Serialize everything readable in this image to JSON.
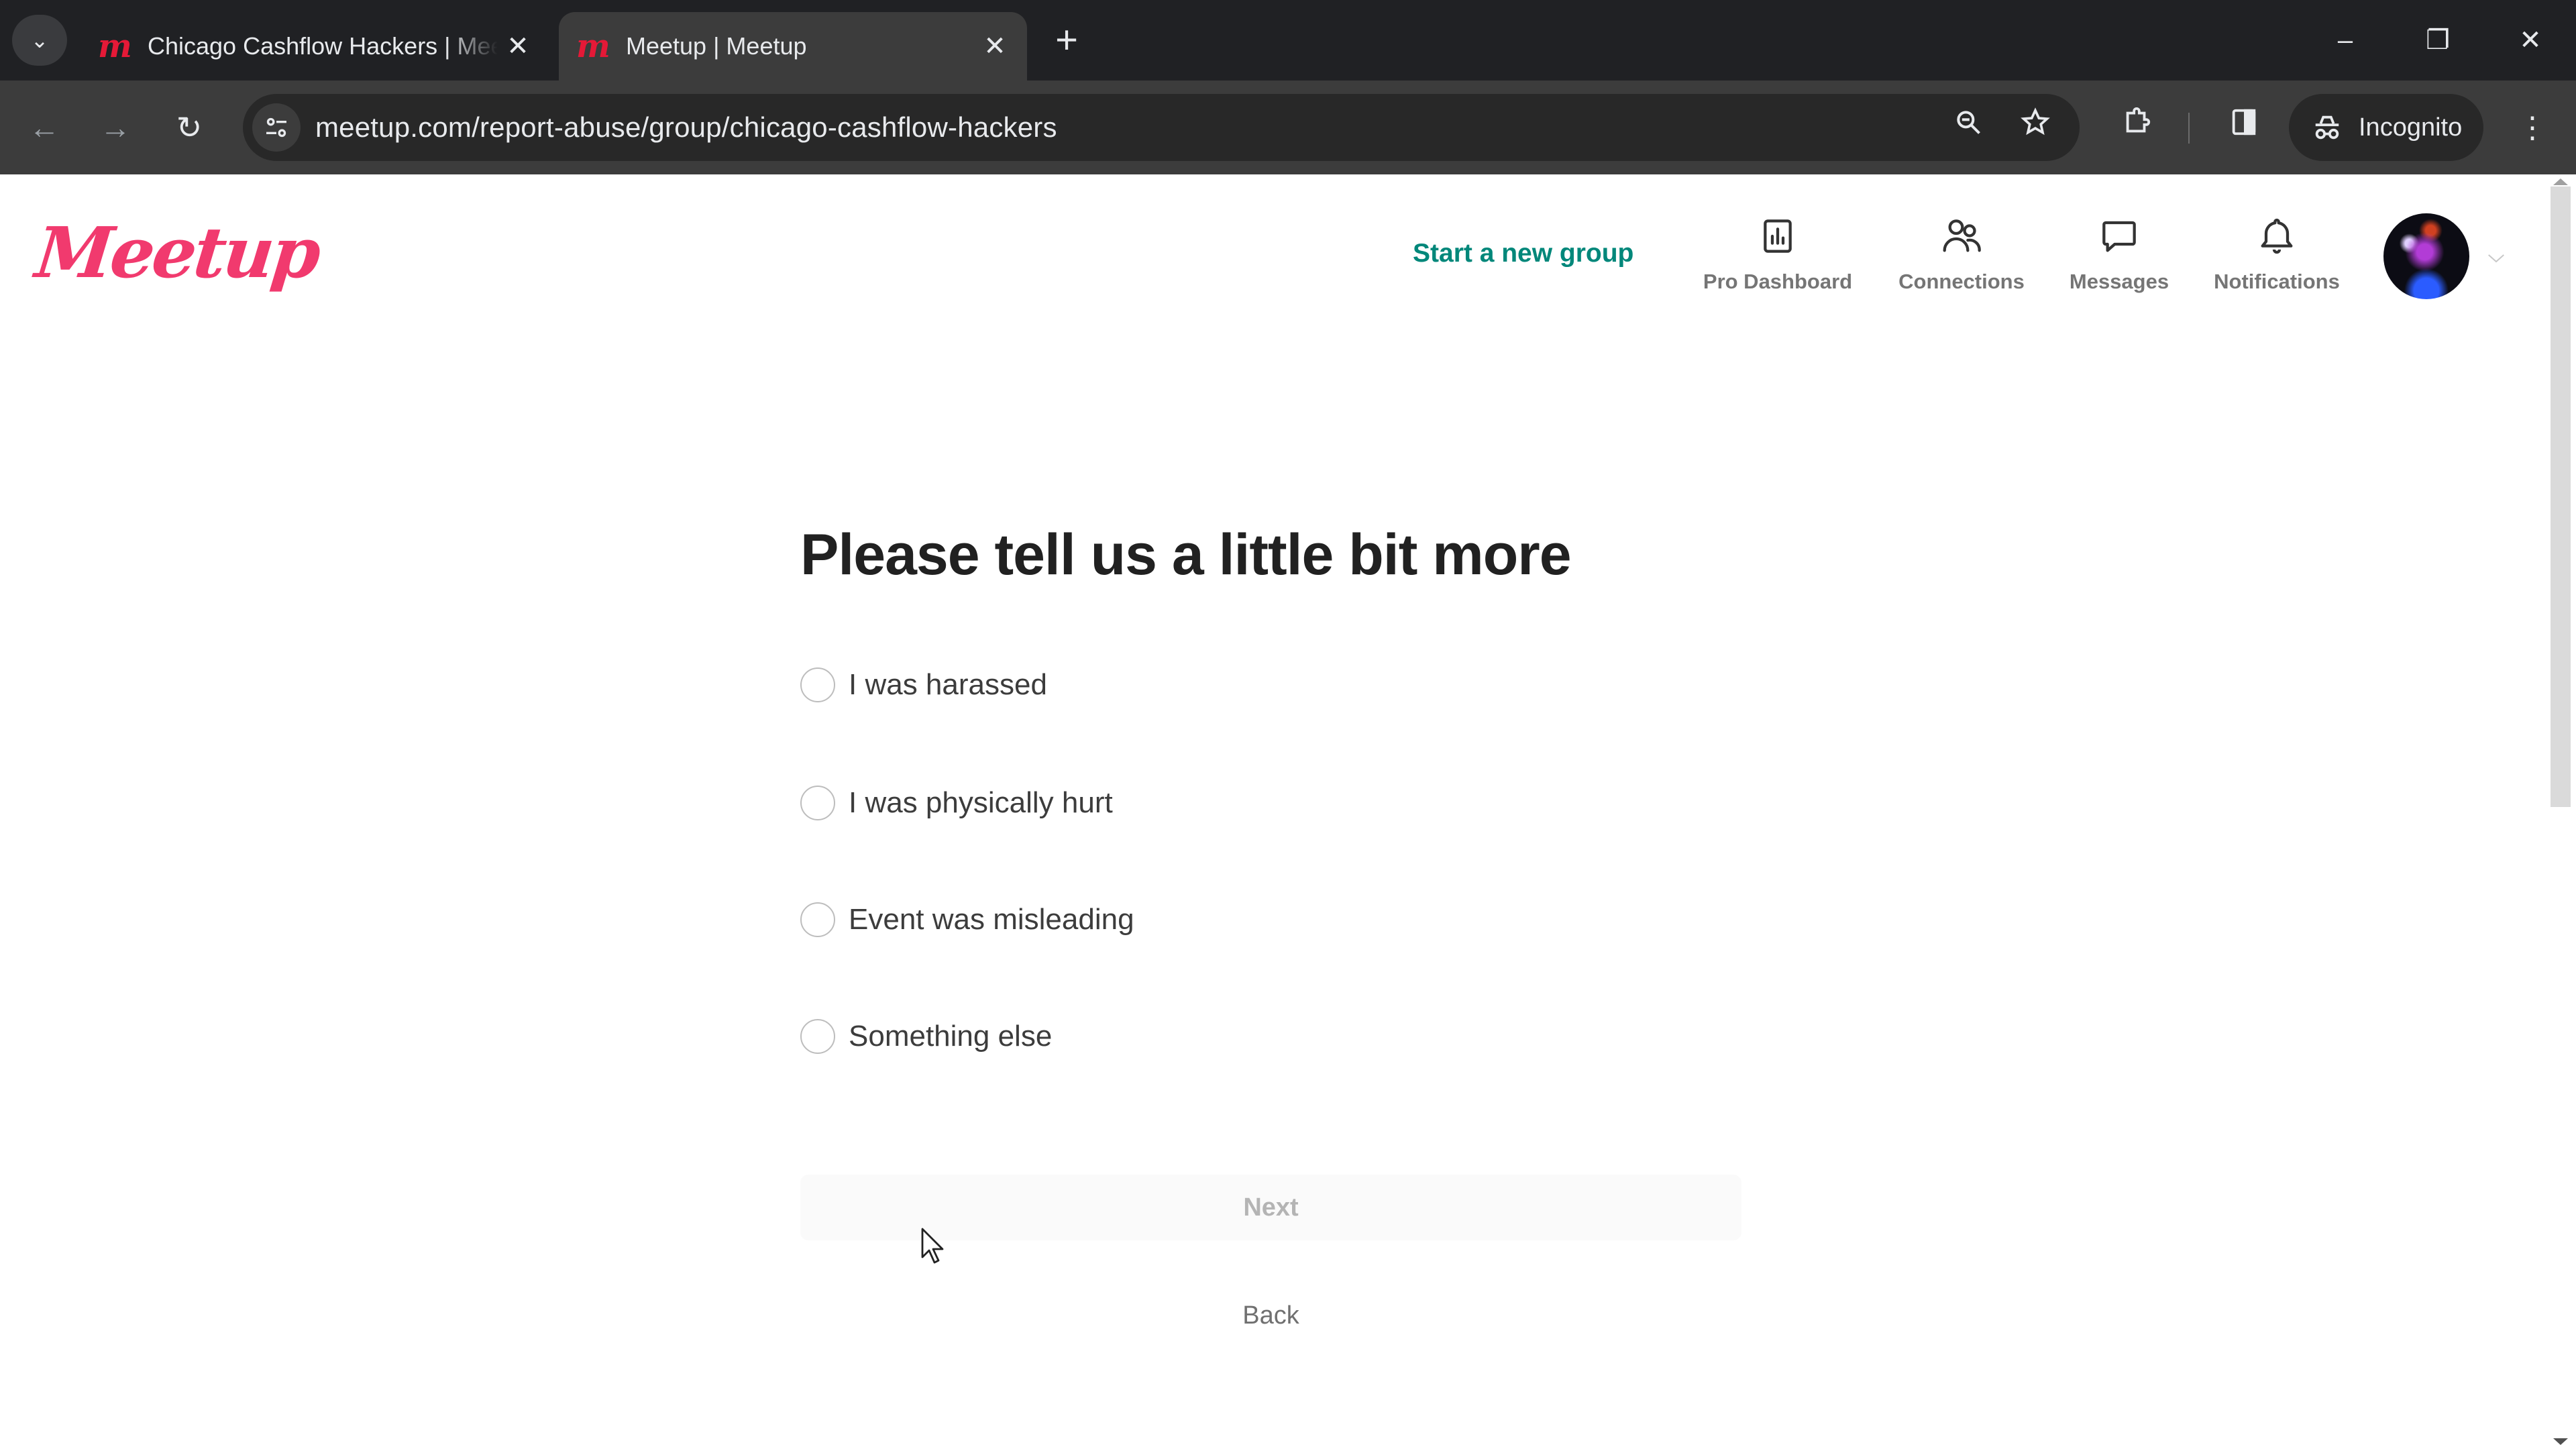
{
  "browser": {
    "tabs": [
      {
        "title": "Chicago Cashflow Hackers | Meetup",
        "active": false,
        "favicon": "meetup-favicon"
      },
      {
        "title": "Meetup | Meetup",
        "active": true,
        "favicon": "meetup-favicon"
      }
    ],
    "url": "meetup.com/report-abuse/group/chicago-cashflow-hackers",
    "profile_label": "Incognito",
    "icons": {
      "tab_search": "⌄",
      "favicon": "m",
      "close": "✕",
      "new_tab": "+",
      "minimize": "–",
      "restore": "❐",
      "window_close": "✕",
      "back": "←",
      "forward": "→",
      "reload": "↻",
      "site_info": "⚙",
      "zoom": "🔍",
      "star": "☆",
      "extensions": "⧉",
      "side_panel": "▯",
      "menu": "⋮"
    }
  },
  "header": {
    "logo_text": "Meetup",
    "start_group_label": "Start a new group",
    "nav": [
      {
        "label": "Pro Dashboard",
        "icon": "bar-chart-icon"
      },
      {
        "label": "Connections",
        "icon": "people-icon"
      },
      {
        "label": "Messages",
        "icon": "chat-bubble-icon"
      },
      {
        "label": "Notifications",
        "icon": "bell-icon"
      }
    ]
  },
  "form": {
    "title": "Please tell us a little bit more",
    "options": [
      {
        "label": "I was harassed",
        "selected": false
      },
      {
        "label": "I was physically hurt",
        "selected": false
      },
      {
        "label": "Event was misleading",
        "selected": false
      },
      {
        "label": "Something else",
        "selected": false
      }
    ],
    "next_label": "Next",
    "next_enabled": false,
    "back_label": "Back"
  },
  "colors": {
    "brand": "#f13a6e",
    "accent_link": "#00877a",
    "chrome_dark": "#202124",
    "chrome_toolbar": "#3c3c3c"
  }
}
